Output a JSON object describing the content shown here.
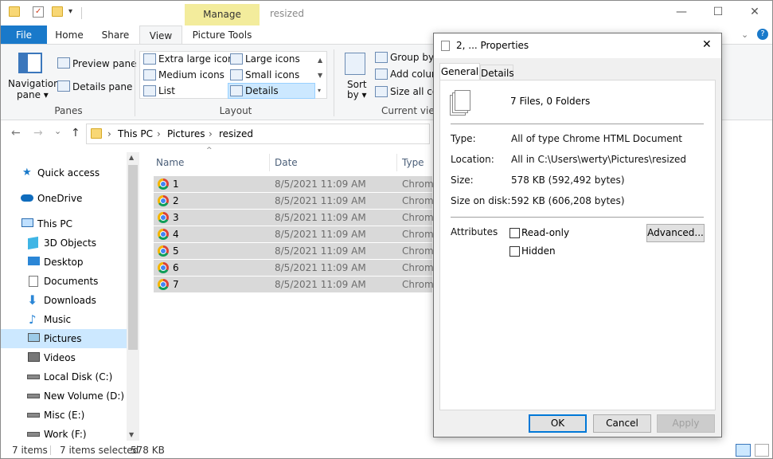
{
  "window": {
    "title": "resized",
    "contextual_tab_group": "Manage",
    "controls": {
      "minimize": "—",
      "maximize": "☐",
      "close": "✕"
    }
  },
  "tabs": {
    "file": "File",
    "home": "Home",
    "share": "Share",
    "view": "View",
    "picture_tools": "Picture Tools"
  },
  "ribbon": {
    "panes": {
      "navigation_pane": "Navigation",
      "navigation_pane2": "pane ▾",
      "preview_pane": "Preview pane",
      "details_pane": "Details pane",
      "label": "Panes"
    },
    "layout": {
      "extra_large_icons": "Extra large icons",
      "large_icons": "Large icons",
      "medium_icons": "Medium icons",
      "small_icons": "Small icons",
      "list": "List",
      "details": "Details",
      "label": "Layout"
    },
    "current_view": {
      "sort_by": "Sort",
      "sort_by2": "by ▾",
      "group_by": "Group by ▾",
      "add_columns": "Add colum",
      "size_all_columns": "Size all colu",
      "label": "Current vie"
    }
  },
  "address": {
    "back": "←",
    "forward": "→",
    "recent": "⌄",
    "up": "↑",
    "crumbs": [
      "This PC",
      "Pictures",
      "resized"
    ],
    "sep": "›"
  },
  "nav": {
    "items": [
      {
        "label": "Quick access"
      },
      {
        "label": "OneDrive"
      },
      {
        "label": "This PC"
      },
      {
        "label": "3D Objects"
      },
      {
        "label": "Desktop"
      },
      {
        "label": "Documents"
      },
      {
        "label": "Downloads"
      },
      {
        "label": "Music"
      },
      {
        "label": "Pictures"
      },
      {
        "label": "Videos"
      },
      {
        "label": "Local Disk (C:)"
      },
      {
        "label": "New Volume (D:)"
      },
      {
        "label": "Misc (E:)"
      },
      {
        "label": "Work (F:)"
      }
    ]
  },
  "files": {
    "columns": {
      "name": "Name",
      "date": "Date",
      "type": "Type"
    },
    "rows": [
      {
        "name": "1",
        "date": "8/5/2021 11:09 AM",
        "type": "Chrome"
      },
      {
        "name": "2",
        "date": "8/5/2021 11:09 AM",
        "type": "Chrome"
      },
      {
        "name": "3",
        "date": "8/5/2021 11:09 AM",
        "type": "Chrome"
      },
      {
        "name": "4",
        "date": "8/5/2021 11:09 AM",
        "type": "Chrome"
      },
      {
        "name": "5",
        "date": "8/5/2021 11:09 AM",
        "type": "Chrome"
      },
      {
        "name": "6",
        "date": "8/5/2021 11:09 AM",
        "type": "Chrome"
      },
      {
        "name": "7",
        "date": "8/5/2021 11:09 AM",
        "type": "Chrome"
      }
    ]
  },
  "status": {
    "items": "7 items",
    "selected": "7 items selected",
    "size": "578 KB"
  },
  "dialog": {
    "title": "2, ... Properties",
    "tabs": {
      "general": "General",
      "details": "Details"
    },
    "summary": "7 Files, 0 Folders",
    "type_label": "Type:",
    "type_value": "All of type Chrome HTML Document",
    "location_label": "Location:",
    "location_value": "All in C:\\Users\\werty\\Pictures\\resized",
    "size_label": "Size:",
    "size_value": "578 KB (592,492 bytes)",
    "size_on_disk_label": "Size on disk:",
    "size_on_disk_value": "592 KB (606,208 bytes)",
    "attributes_label": "Attributes",
    "readonly": "Read-only",
    "hidden": "Hidden",
    "advanced": "Advanced...",
    "ok": "OK",
    "cancel": "Cancel",
    "apply": "Apply",
    "close": "✕"
  },
  "colors": {
    "accent": "#1979ca",
    "selection": "#cce8ff",
    "manage": "#f3ec9c"
  }
}
